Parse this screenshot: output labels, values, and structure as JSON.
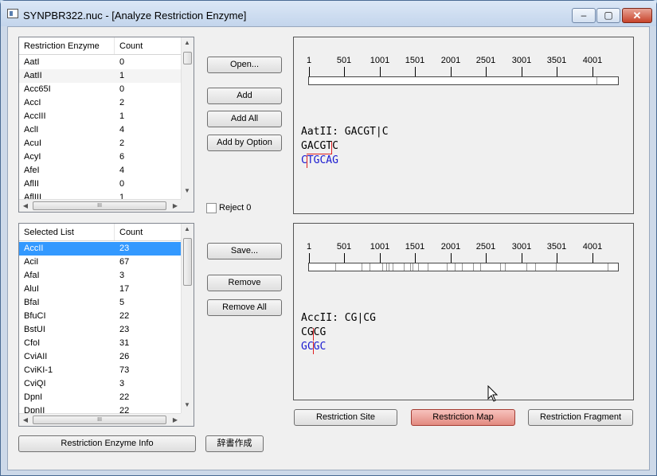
{
  "window": {
    "title": "SYNPBR322.nuc - [Analyze Restriction Enzyme]",
    "min_glyph": "–",
    "max_glyph": "▢",
    "close_glyph": "✕"
  },
  "enzyme_list": {
    "columns": [
      "Restriction Enzyme",
      "Count"
    ],
    "rows": [
      {
        "name": "AatI",
        "count": "0"
      },
      {
        "name": "AatII",
        "count": "1"
      },
      {
        "name": "Acc65I",
        "count": "0"
      },
      {
        "name": "AccI",
        "count": "2"
      },
      {
        "name": "AccIII",
        "count": "1"
      },
      {
        "name": "AclI",
        "count": "4"
      },
      {
        "name": "AcuI",
        "count": "2"
      },
      {
        "name": "AcyI",
        "count": "6"
      },
      {
        "name": "AfeI",
        "count": "4"
      },
      {
        "name": "AflII",
        "count": "0"
      },
      {
        "name": "AflIII",
        "count": "1"
      }
    ]
  },
  "selected_list": {
    "columns": [
      "Selected List",
      "Count"
    ],
    "rows": [
      {
        "name": "AccII",
        "count": "23"
      },
      {
        "name": "AciI",
        "count": "67"
      },
      {
        "name": "AfaI",
        "count": "3"
      },
      {
        "name": "AluI",
        "count": "17"
      },
      {
        "name": "BfaI",
        "count": "5"
      },
      {
        "name": "BfuCI",
        "count": "22"
      },
      {
        "name": "BstUI",
        "count": "23"
      },
      {
        "name": "CfoI",
        "count": "31"
      },
      {
        "name": "CviAII",
        "count": "26"
      },
      {
        "name": "CviKI-1",
        "count": "73"
      },
      {
        "name": "CviQI",
        "count": "3"
      },
      {
        "name": "DpnI",
        "count": "22"
      },
      {
        "name": "DpnII",
        "count": "22"
      }
    ]
  },
  "buttons": {
    "open": "Open...",
    "add": "Add",
    "add_all": "Add All",
    "add_by_option": "Add by Option",
    "reject0": "Reject 0",
    "save": "Save...",
    "remove": "Remove",
    "remove_all": "Remove All",
    "enzyme_info": "Restriction Enzyme Info",
    "dictionary": "辞書作成",
    "restriction_site": "Restriction Site",
    "restriction_map": "Restriction Map",
    "restriction_fragment": "Restriction Fragment"
  },
  "ruler_labels": [
    "1",
    "501",
    "1001",
    "1501",
    "2001",
    "2501",
    "3001",
    "3501",
    "4001"
  ],
  "top_panel": {
    "site_label": "AatII: GACGT|C",
    "strand_top": "GACGTC",
    "strand_bottom": "CTGCAG",
    "cut_positions": [
      4043
    ]
  },
  "bottom_panel": {
    "site_label": "AccII: CG|CG",
    "strand_top": "CGCG",
    "strand_bottom": "GCGC",
    "cut_positions": [
      360,
      730,
      845,
      1020,
      1080,
      1115,
      1175,
      1330,
      1415,
      1455,
      1525,
      1660,
      1930,
      2045,
      2145,
      2310,
      2410,
      2690,
      2755,
      3060,
      3185,
      3470,
      4205
    ]
  }
}
